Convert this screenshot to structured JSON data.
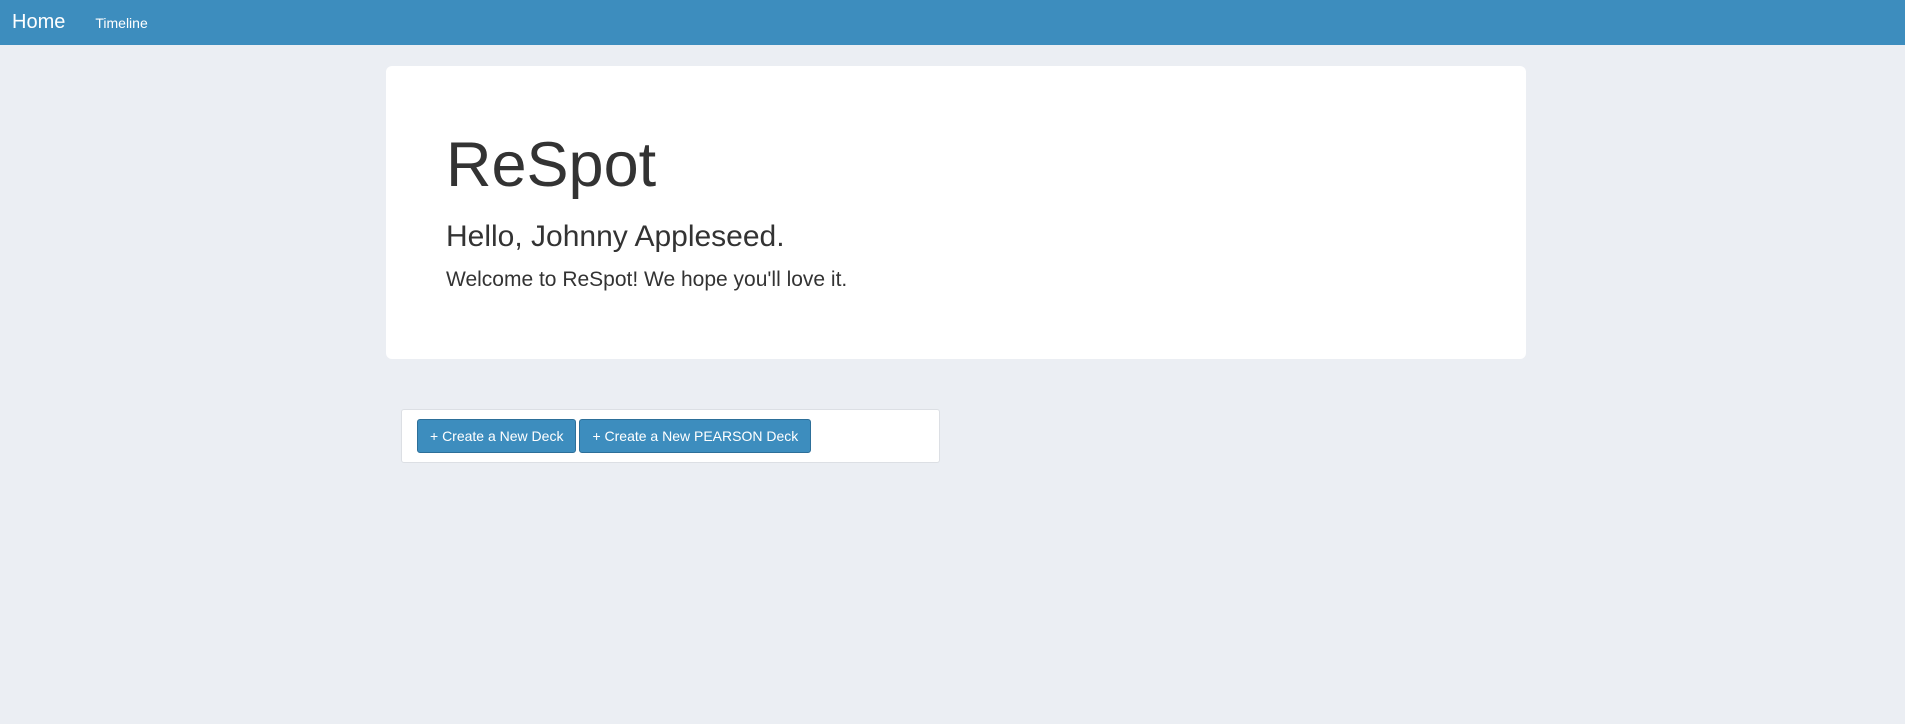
{
  "navbar": {
    "brand": "Home",
    "links": [
      "Timeline"
    ]
  },
  "jumbotron": {
    "title": "ReSpot",
    "greeting": "Hello, Johnny Appleseed.",
    "welcome": "Welcome to ReSpot! We hope you'll love it."
  },
  "actions": {
    "create_deck_label": "+ Create a New Deck",
    "create_pearson_deck_label": "+ Create a New PEARSON Deck"
  },
  "colors": {
    "navbar": "#3d8dbe",
    "background": "#ebeef3",
    "button": "#3d8dbe"
  }
}
